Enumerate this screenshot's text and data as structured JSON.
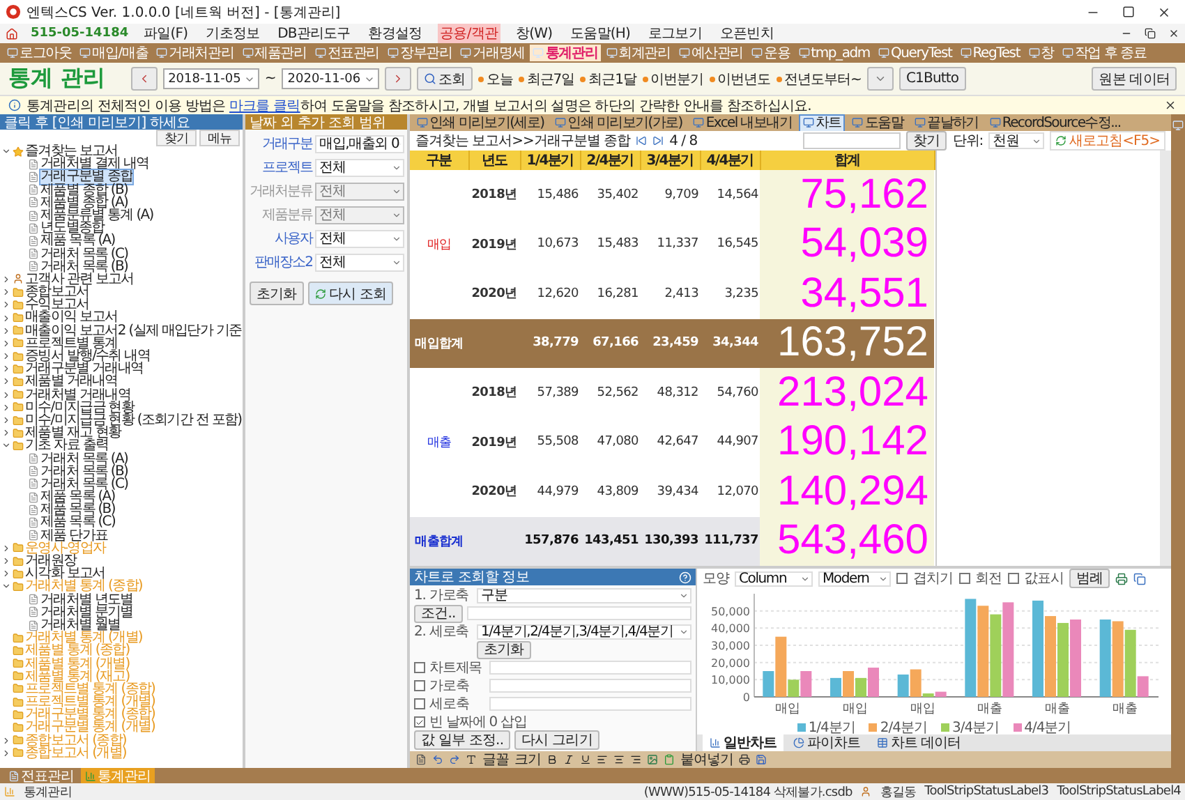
{
  "window": {
    "title": "엔텍스CS Ver. 1.0.0.0 [네트웍 버전] - [통계관리]"
  },
  "menu": {
    "phone": "515-05-14184",
    "items": [
      {
        "label": "파일(F)",
        "highlighted": false
      },
      {
        "label": "기초정보",
        "highlighted": false
      },
      {
        "label": "DB관리도구",
        "highlighted": false
      },
      {
        "label": "환경설정",
        "highlighted": false
      },
      {
        "label": "공용/객관",
        "highlighted": true
      },
      {
        "label": "창(W)",
        "highlighted": false
      },
      {
        "label": "도움말(H)",
        "highlighted": false
      },
      {
        "label": "로그보기",
        "highlighted": false
      },
      {
        "label": "오픈빈치",
        "highlighted": false
      }
    ]
  },
  "toolbar": [
    {
      "label": "로그아웃",
      "selected": false
    },
    {
      "label": "매입/매출",
      "selected": false
    },
    {
      "label": "거래처관리",
      "selected": false
    },
    {
      "label": "제품관리",
      "selected": false
    },
    {
      "label": "전표관리",
      "selected": false
    },
    {
      "label": "장부관리",
      "selected": false
    },
    {
      "label": "거래명세",
      "selected": false
    },
    {
      "label": "통계관리",
      "selected": true
    },
    {
      "label": "회계관리",
      "selected": false
    },
    {
      "label": "예산관리",
      "selected": false
    },
    {
      "label": "운용",
      "selected": false
    },
    {
      "label": "tmp_adm",
      "selected": false
    },
    {
      "label": "QueryTest",
      "selected": false
    },
    {
      "label": "RegTest",
      "selected": false
    },
    {
      "label": "창",
      "selected": false
    },
    {
      "label": "작업 후 종료",
      "selected": false
    }
  ],
  "header": {
    "title": "통계 관리",
    "date_from": "2018-11-05",
    "date_separator": "~",
    "date_to": "2020-11-06",
    "search_button": "조회",
    "quick_ranges": [
      "오늘",
      "최근7일",
      "최근1달",
      "이번분기",
      "이번년도",
      "전년도부터~"
    ],
    "extra_button": "C1Butto",
    "source_button": "원본 데이터"
  },
  "info": {
    "before": "통계관리의 전체적인 이용 방법은 ",
    "link": "마크를 클릭",
    "after": "하여 도움말을 참조하시고, 개별 보고서의 설명은 하단의 간략한 안내를 참조하십시요."
  },
  "sidebar": {
    "hint": "클릭 후 [인쇄 미리보기] 하세요",
    "buttons": [
      "찾기",
      "메뉴"
    ],
    "tree": [
      {
        "label": "즐겨찾는 보고서",
        "kind": "star",
        "color": "#222222",
        "selected": false,
        "expanded": true,
        "children": [
          {
            "label": "거래처별 결제 내역",
            "kind": "doc",
            "selected": false
          },
          {
            "label": "거래구분별 종합",
            "kind": "doc",
            "selected": true
          },
          {
            "label": "제품별 종합 (B)",
            "kind": "doc",
            "selected": false
          },
          {
            "label": "제품별 종합 (A)",
            "kind": "doc",
            "selected": false
          },
          {
            "label": "제품분류별 통계 (A)",
            "kind": "doc",
            "selected": false
          },
          {
            "label": "년도별종합",
            "kind": "doc",
            "selected": false
          },
          {
            "label": "제품 목록 (A)",
            "kind": "doc",
            "selected": false
          },
          {
            "label": "거래처 목록 (C)",
            "kind": "doc",
            "selected": false
          },
          {
            "label": "거래처 목록 (B)",
            "kind": "doc",
            "selected": false
          }
        ]
      },
      {
        "label": "고객사 관련 보고서",
        "kind": "person",
        "color": "#222222",
        "selected": false,
        "expanded": false
      },
      {
        "label": "종합보고서",
        "kind": "folder",
        "color": "#222222",
        "selected": false,
        "expanded": false
      },
      {
        "label": "수익보고서",
        "kind": "folder",
        "color": "#222222",
        "selected": false,
        "expanded": false
      },
      {
        "label": "매출이익 보고서",
        "kind": "folder",
        "color": "#222222",
        "selected": false,
        "expanded": false
      },
      {
        "label": "매출이익 보고서2 (실제 매입단가 기준",
        "kind": "folder",
        "color": "#222222",
        "selected": false,
        "expanded": false
      },
      {
        "label": "프로젝트별 통계",
        "kind": "folder",
        "color": "#222222",
        "selected": false,
        "expanded": false
      },
      {
        "label": "증빙서 발행/수취 내역",
        "kind": "folder",
        "color": "#222222",
        "selected": false,
        "expanded": false
      },
      {
        "label": "거래구분별 거래내역",
        "kind": "folder",
        "color": "#222222",
        "selected": false,
        "expanded": false
      },
      {
        "label": "제품별 거래내역",
        "kind": "folder",
        "color": "#222222",
        "selected": false,
        "expanded": false
      },
      {
        "label": "거래처별 거래내역",
        "kind": "folder",
        "color": "#222222",
        "selected": false,
        "expanded": false
      },
      {
        "label": "미수/미지급금 현황",
        "kind": "folder",
        "color": "#222222",
        "selected": false,
        "expanded": false
      },
      {
        "label": "미수/미지급금 현황 (조회기간 전 포함)",
        "kind": "folder",
        "color": "#222222",
        "selected": false,
        "expanded": false
      },
      {
        "label": "제품별 재고 현황",
        "kind": "folder",
        "color": "#222222",
        "selected": false,
        "expanded": false
      },
      {
        "label": "기초 자료 출력",
        "kind": "folder",
        "color": "#222222",
        "selected": false,
        "expanded": true,
        "children": [
          {
            "label": "거래처 목록 (A)",
            "kind": "doc",
            "selected": false
          },
          {
            "label": "거래처 목록 (B)",
            "kind": "doc",
            "selected": false
          },
          {
            "label": "거래처 목록 (C)",
            "kind": "doc",
            "selected": false
          },
          {
            "label": "제품 목록 (A)",
            "kind": "doc",
            "selected": false
          },
          {
            "label": "제품 목록 (B)",
            "kind": "doc",
            "selected": false
          },
          {
            "label": "제품 목록 (C)",
            "kind": "doc",
            "selected": false
          },
          {
            "label": "제품 단가표",
            "kind": "doc",
            "selected": false
          }
        ]
      },
      {
        "label": "운영사-영업자",
        "kind": "folder",
        "color": "#e89a20",
        "selected": false,
        "expanded": false
      },
      {
        "label": "거래원장",
        "kind": "folder",
        "color": "#222222",
        "selected": false,
        "expanded": false
      },
      {
        "label": "시각화 보고서",
        "kind": "folder",
        "color": "#222222",
        "selected": false,
        "expanded": false
      },
      {
        "label": "거래처별 통계 (종합)",
        "kind": "folder",
        "color": "#e89a20",
        "selected": false,
        "expanded": true,
        "children": [
          {
            "label": "거래처별 년도별",
            "kind": "doc",
            "selected": false
          },
          {
            "label": "거래처별 분기별",
            "kind": "doc",
            "selected": false
          },
          {
            "label": "거래처별 월별",
            "kind": "doc",
            "selected": false
          }
        ]
      },
      {
        "label": "거래처별 통계 (개별)",
        "kind": "folder",
        "color": "#e89a20",
        "selected": false
      },
      {
        "label": "제품별 통계 (종합)",
        "kind": "folder",
        "color": "#e89a20",
        "selected": false
      },
      {
        "label": "제품별 통계 (개별)",
        "kind": "folder",
        "color": "#e89a20",
        "selected": false
      },
      {
        "label": "제품별 통계 (재고)",
        "kind": "folder",
        "color": "#e89a20",
        "selected": false
      },
      {
        "label": "프로젝트별 통계 (종합)",
        "kind": "folder",
        "color": "#e89a20",
        "selected": false
      },
      {
        "label": "프로젝트별 통계 (개별)",
        "kind": "folder",
        "color": "#e89a20",
        "selected": false
      },
      {
        "label": "거래구분별 통계 (종합)",
        "kind": "folder",
        "color": "#e89a20",
        "selected": false
      },
      {
        "label": "거래구분별 통계 (개별)",
        "kind": "folder",
        "color": "#e89a20",
        "selected": false
      },
      {
        "label": "종합보고서 (종합)",
        "kind": "folder",
        "color": "#e89a20",
        "selected": false,
        "expanded": false
      },
      {
        "label": "종합보고서 (개별)",
        "kind": "folder",
        "color": "#e89a20",
        "selected": false,
        "expanded": false
      }
    ]
  },
  "filters": {
    "title": "날짜 외 추가 조회 범위",
    "fields": [
      {
        "label": "거래구분",
        "value": "매입,매출외 0",
        "disabled": false
      },
      {
        "label": "프로젝트",
        "value": "전체",
        "disabled": false
      },
      {
        "label": "거래처분류",
        "value": "전체",
        "disabled": true
      },
      {
        "label": "제품분류",
        "value": "전체",
        "disabled": true
      },
      {
        "label": "사용자",
        "value": "전체",
        "disabled": false
      },
      {
        "label": "판매장소2",
        "value": "전체",
        "disabled": false
      }
    ],
    "reset_button": "초기화",
    "reload_button": "다시 조회"
  },
  "report": {
    "tools": [
      {
        "label": "인쇄 미리보기(세로)",
        "selected": false
      },
      {
        "label": "인쇄 미리보기(가로)",
        "selected": false
      },
      {
        "label": "Excel 내보내기",
        "selected": false
      },
      {
        "label": "차트",
        "selected": true
      },
      {
        "label": "도움말",
        "selected": false
      },
      {
        "label": "끝날하기",
        "selected": false
      },
      {
        "label": "RecordSource수정...",
        "selected": false
      }
    ],
    "breadcrumb": "즐겨찾는 보고서>>거래구분별 종합",
    "page": "4 / 8",
    "find_button": "찾기",
    "unit_label": "단위:",
    "unit": "천원",
    "refresh_button": "새로고침<F5>"
  },
  "table": {
    "columns": [
      "구분",
      "년도",
      "1/4분기",
      "2/4분기",
      "3/4분기",
      "4/4분기",
      "합계"
    ],
    "groups": [
      {
        "label": "매입",
        "color": "#e02020",
        "rows": [
          {
            "year": "2018년",
            "values": [
              "15,486",
              "35,402",
              "9,709",
              "14,564"
            ],
            "total": "75,162"
          },
          {
            "year": "2019년",
            "values": [
              "10,673",
              "15,483",
              "11,337",
              "16,545"
            ],
            "total": "54,039"
          },
          {
            "year": "2020년",
            "values": [
              "12,620",
              "16,281",
              "2,413",
              "3,235"
            ],
            "total": "34,551"
          }
        ],
        "subtotal": {
          "kind": "dark",
          "label": "매입합계",
          "values": [
            "38,779",
            "67,166",
            "23,459",
            "34,344"
          ],
          "total": "163,752"
        }
      },
      {
        "label": "매출",
        "color": "#2030e0",
        "rows": [
          {
            "year": "2018년",
            "values": [
              "57,389",
              "52,562",
              "48,312",
              "54,760"
            ],
            "total": "213,024"
          },
          {
            "year": "2019년",
            "values": [
              "55,508",
              "47,080",
              "42,647",
              "44,907"
            ],
            "total": "190,142"
          },
          {
            "year": "2020년",
            "values": [
              "44,979",
              "43,809",
              "39,434",
              "12,070"
            ],
            "total": "140,294"
          }
        ],
        "subtotal": {
          "kind": "light",
          "label": "매출합계",
          "values": [
            "157,876",
            "143,451",
            "130,393",
            "111,737"
          ],
          "total": "543,460"
        }
      }
    ]
  },
  "chart_panel": {
    "title": "차트로 조회할 정보",
    "x_axis_label": "1. 가로축",
    "x_axis": "구분",
    "condition_button": "조건..",
    "y_axis_label": "2. 세로축",
    "y_axis": "1/4분기,2/4분기,3/4분기,4/4분기",
    "reset_button": "초기화",
    "options": [
      {
        "label": "차트제목",
        "checked": false
      },
      {
        "label": "가로축",
        "checked": false
      },
      {
        "label": "세로축",
        "checked": false
      }
    ],
    "zero_fill": {
      "label": "빈 날짜에 0 삽입",
      "checked": true
    },
    "buttons": [
      "값 일부 조정..",
      "다시 그리기"
    ]
  },
  "chart": {
    "shape_label": "모양",
    "shape": "Column",
    "style": "Modern",
    "toggles": [
      {
        "label": "겹치기",
        "checked": false
      },
      {
        "label": "회전",
        "checked": false
      },
      {
        "label": "값표시",
        "checked": false
      }
    ],
    "legend_button": "범례",
    "chart_data": {
      "type": "bar",
      "categories": [
        "매입",
        "매입",
        "매입",
        "매출",
        "매출",
        "매출"
      ],
      "series": [
        {
          "name": "1/4분기",
          "color": "#5bb8d6",
          "values": [
            15000,
            11000,
            13000,
            57000,
            56000,
            45000
          ]
        },
        {
          "name": "2/4분기",
          "color": "#f5a85a",
          "values": [
            35000,
            15000,
            16000,
            53000,
            47000,
            44000
          ]
        },
        {
          "name": "3/4분기",
          "color": "#9fd05a",
          "values": [
            10000,
            11000,
            2000,
            48000,
            43000,
            39000
          ]
        },
        {
          "name": "4/4분기",
          "color": "#ea88ba",
          "values": [
            15000,
            17000,
            3000,
            55000,
            45000,
            12000
          ]
        }
      ],
      "grid": true,
      "ylim": [
        0,
        60000
      ],
      "yticks": [
        {
          "value": 0,
          "label": "0"
        },
        {
          "value": 10000,
          "label": "10,000"
        },
        {
          "value": 20000,
          "label": "20,000"
        },
        {
          "value": 30000,
          "label": "30,000"
        },
        {
          "value": 40000,
          "label": "40,000"
        },
        {
          "value": 50000,
          "label": "50,000"
        }
      ]
    },
    "tabs": [
      {
        "label": "일반차트",
        "selected": true
      },
      {
        "label": "파이차트",
        "selected": false
      },
      {
        "label": "차트 데이터",
        "selected": false
      }
    ]
  },
  "editor": {
    "font": "글꼴",
    "size": "크기",
    "paste": "붙여넣기"
  },
  "taskbar": [
    {
      "label": "전표관리",
      "selected": false
    },
    {
      "label": "통계관리",
      "selected": true
    }
  ],
  "status": {
    "left": "통계관리",
    "file": "(WWW)515-05-14184 삭제불가.csdb",
    "user": "홍길동",
    "labels": [
      "ToolStripStatusLabel3",
      "ToolStripStatusLabel4"
    ]
  }
}
